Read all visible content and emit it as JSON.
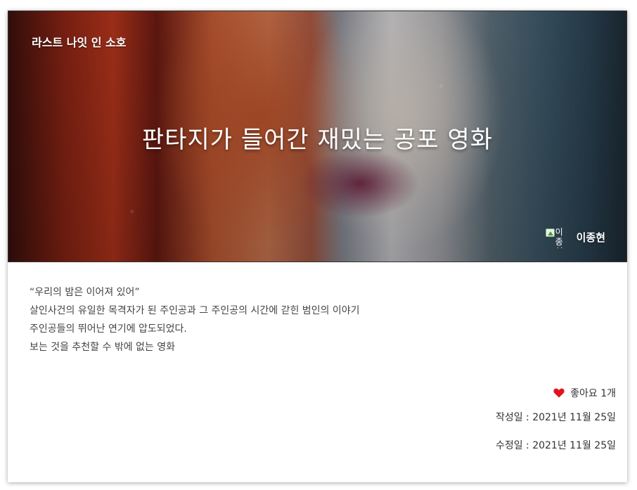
{
  "brand": "라스트 나잇 인 소호",
  "hero": {
    "title": "판타지가 들어간 재밌는 공포 영화",
    "avatar_alt": "이종현",
    "author": "이종현"
  },
  "content": {
    "lines": [
      "“우리의 밤은 이어져 있어”",
      "살인사건의 유일한 목격자가 된 주인공과 그 주인공의 시간에 갇힌 범인의 이야기",
      "주인공들의 뛰어난 연기에 압도되었다.",
      "보는 것을 추천할 수 밖에 없는 영화"
    ]
  },
  "meta": {
    "likes_label": "좋아요 1개",
    "created": "작성일 : 2021년 11월 25일",
    "updated": "수정일 : 2021년 11월 25일"
  },
  "colors": {
    "heart": "#e0141e",
    "text": "#444444"
  }
}
